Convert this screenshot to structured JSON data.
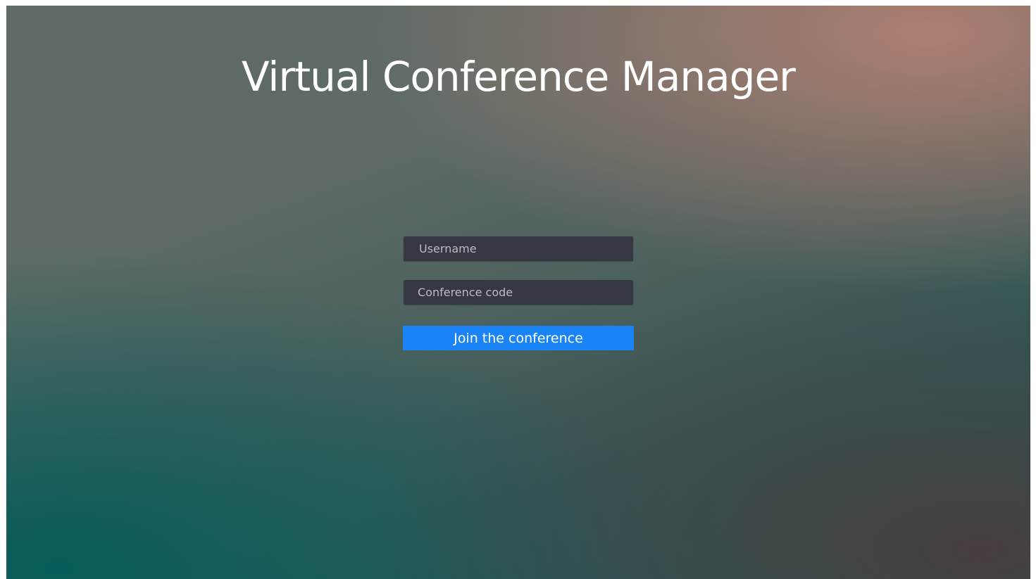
{
  "app": {
    "title": "Virtual Conference Manager"
  },
  "form": {
    "username_placeholder": "Username",
    "username_value": "",
    "code_placeholder": "Conference code",
    "code_value": "",
    "join_label": "Join the conference"
  },
  "colors": {
    "accent": "#1a84f7",
    "field_bg": "#353840",
    "title": "#ffffff"
  }
}
